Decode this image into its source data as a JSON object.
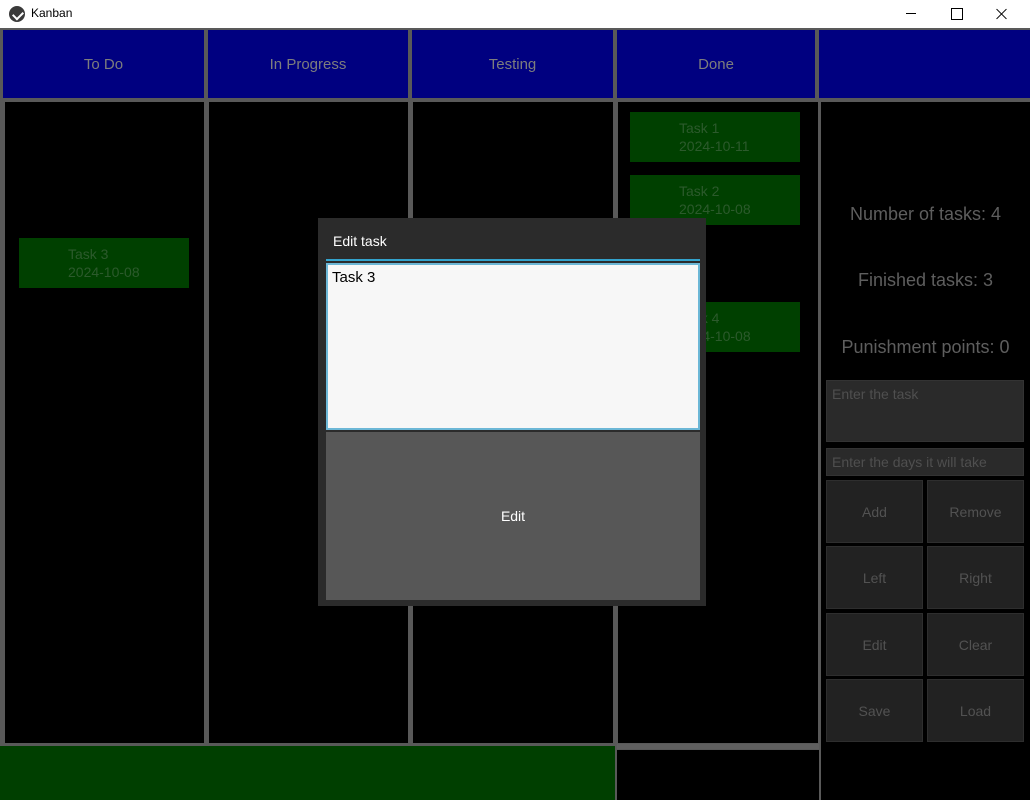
{
  "window": {
    "title": "Kanban"
  },
  "board": {
    "columns": [
      {
        "label": "To Do"
      },
      {
        "label": "In Progress"
      },
      {
        "label": "Testing"
      },
      {
        "label": "Done"
      }
    ],
    "extra_header": ""
  },
  "tasks": {
    "todo": [
      {
        "name": "Task 3",
        "date": "2024-10-08"
      }
    ],
    "done": [
      {
        "name": "Task 1",
        "date": "2024-10-11"
      },
      {
        "name": "Task 2",
        "date": "2024-10-08"
      },
      {
        "name": "Task 4",
        "date": "2024-10-08"
      }
    ]
  },
  "stats": {
    "number_of_tasks": "Number of tasks: 4",
    "finished_tasks": "Finished tasks: 3",
    "punishment_points": "Punishment points: 0"
  },
  "inputs": {
    "task_placeholder": "Enter the task",
    "days_placeholder": "Enter the days it will take"
  },
  "controls": {
    "add": "Add",
    "remove": "Remove",
    "left": "Left",
    "right": "Right",
    "edit": "Edit",
    "clear": "Clear",
    "save": "Save",
    "load": "Load"
  },
  "dialog": {
    "title": "Edit task",
    "value": "Task 3",
    "button": "Edit"
  },
  "colors": {
    "header_bg": "#000080",
    "card_bg": "#004000",
    "dialog_accent": "#33a3cc"
  }
}
